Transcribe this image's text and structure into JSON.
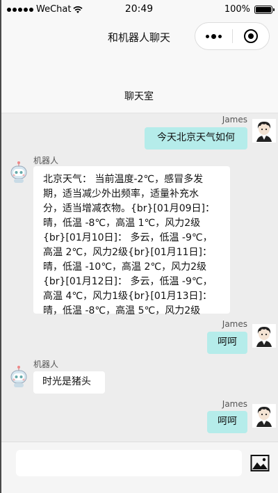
{
  "status_bar": {
    "carrier": "WeChat",
    "time": "20:49",
    "battery": "100%",
    "battery_level": 1.0
  },
  "nav": {
    "title": "和机器人聊天"
  },
  "room": {
    "title": "聊天室"
  },
  "messages": [
    {
      "sender": "James",
      "text": "今天北京天气如何",
      "from": "me"
    },
    {
      "sender": "机器人",
      "text": "北京天气： 当前温度-2℃，感冒多发\n期，适当减少外出频率，适量补充水\n分，适当增减衣物。{br}[01月09日]：\n晴，低温 -8℃，高温 1℃，风力2级\n{br}[01月10日]： 多云，低温 -9℃，\n高温 2℃，风力2级{br}[01月11日]：\n晴，低温 -10℃，高温 2℃，风力2级\n{br}[01月12日]： 多云，低温 -9℃，\n高温 4℃，风力1级{br}[01月13日]：\n晴，低温 -8℃，高温 5℃，风力2级",
      "from": "bot"
    },
    {
      "sender": "James",
      "text": "呵呵",
      "from": "me"
    },
    {
      "sender": "机器人",
      "text": "时光是猪头",
      "from": "bot"
    },
    {
      "sender": "James",
      "text": "呵呵",
      "from": "me"
    }
  ],
  "input": {
    "value": "",
    "placeholder": ""
  },
  "icons": {
    "image_button": "image-icon",
    "user_avatar": "user-avatar-icon",
    "bot_avatar": "robot-avatar-icon",
    "close": "close-circle-icon",
    "more": "more-dots-icon"
  },
  "colors": {
    "my_bubble": "#b5ecea",
    "bot_bubble": "#ffffff",
    "chat_bg": "#ededed"
  }
}
